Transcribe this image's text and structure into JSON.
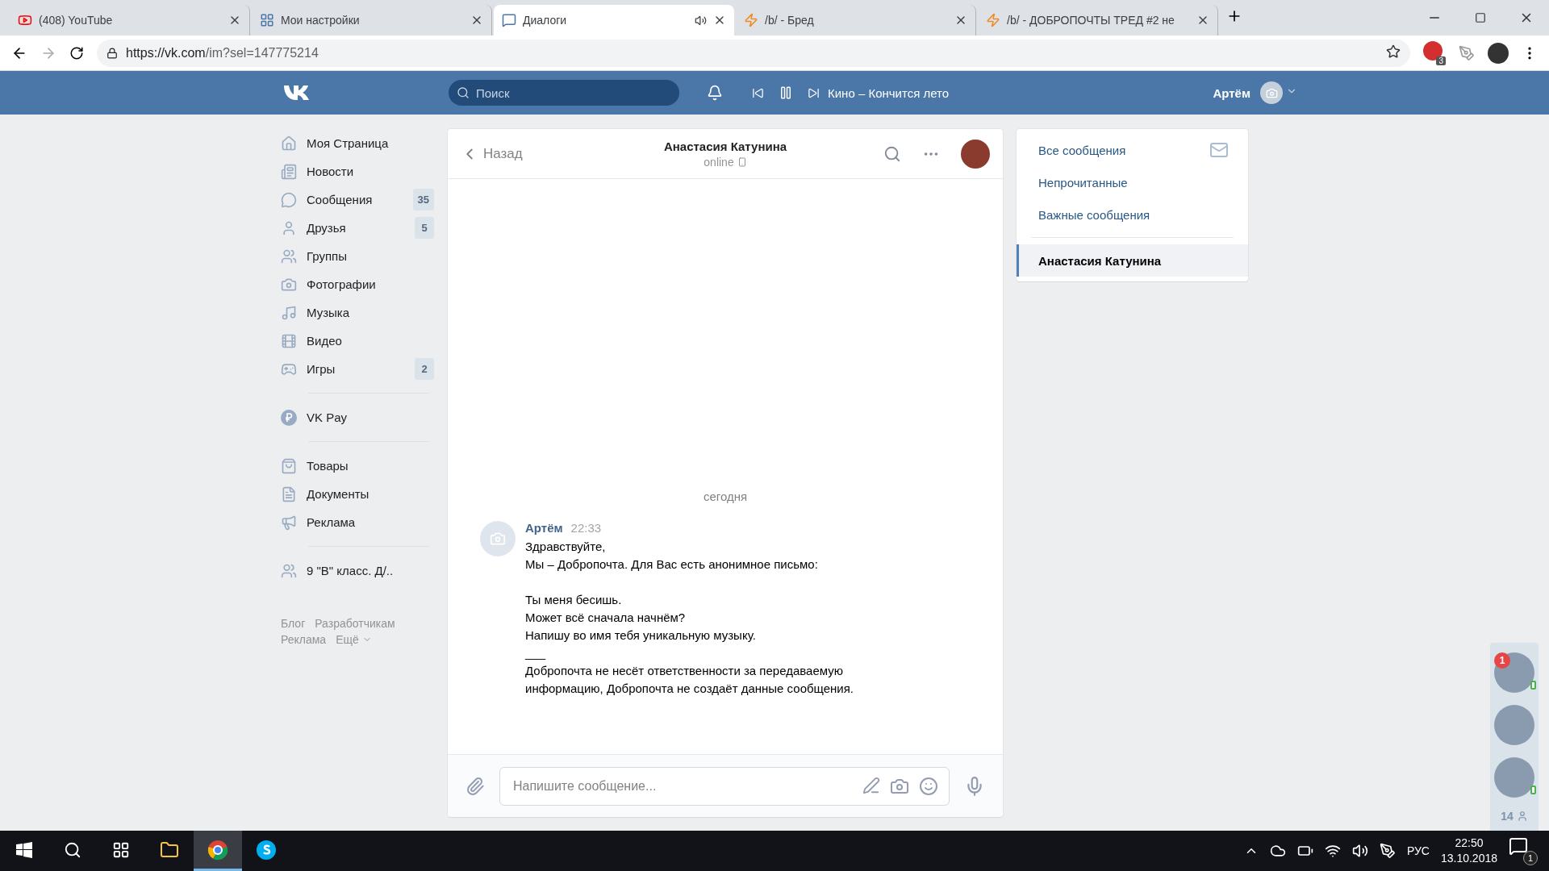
{
  "browser": {
    "tabs": [
      {
        "title": "(408) YouTube",
        "kind": "youtube",
        "selected": false,
        "audio": false
      },
      {
        "title": "Мои настройки",
        "kind": "vk",
        "selected": false,
        "audio": false
      },
      {
        "title": "Диалоги",
        "kind": "chat",
        "selected": true,
        "audio": true
      },
      {
        "title": "/b/ - Бред",
        "kind": "bolt",
        "selected": false,
        "audio": false
      },
      {
        "title": "/b/ - ДОБРОПОЧТЫ ТРЕД #2 не",
        "kind": "bolt",
        "selected": false,
        "audio": false
      }
    ],
    "url_host": "https://vk.com",
    "url_path": "/im?sel=147775214",
    "extension_badge": "3"
  },
  "header": {
    "search_placeholder": "Поиск",
    "track": "Кино – Кончится лето",
    "user": "Артём"
  },
  "sidebar": {
    "groups": [
      [
        {
          "label": "Моя Страница",
          "kind": "home"
        },
        {
          "label": "Новости",
          "kind": "news"
        },
        {
          "label": "Сообщения",
          "kind": "messages",
          "count": "35"
        },
        {
          "label": "Друзья",
          "kind": "user",
          "count": "5"
        },
        {
          "label": "Группы",
          "kind": "users"
        },
        {
          "label": "Фотографии",
          "kind": "camera"
        },
        {
          "label": "Музыка",
          "kind": "music"
        },
        {
          "label": "Видео",
          "kind": "film"
        },
        {
          "label": "Игры",
          "kind": "gamepad",
          "count": "2"
        }
      ],
      [
        {
          "label": "VK Pay",
          "kind": "pay"
        }
      ],
      [
        {
          "label": "Товары",
          "kind": "bag"
        },
        {
          "label": "Документы",
          "kind": "file"
        },
        {
          "label": "Реклама",
          "kind": "megaphone"
        }
      ],
      [
        {
          "label": "9 \"В\" класс. Д/..",
          "kind": "users"
        }
      ]
    ],
    "footer": [
      "Блог",
      "Разработчикам",
      "Реклама",
      "Ещё"
    ]
  },
  "chat": {
    "back": "Назад",
    "name": "Анастасия Катунина",
    "status": "online",
    "date": "сегодня",
    "messages": [
      {
        "author": "Артём",
        "time": "22:33",
        "paragraphs": [
          "Здравствуйте,\nМы – Добропочта. Для Вас есть анонимное письмо:",
          "Ты меня бесишь.\nМожет всё сначала начнём?\nНапишу во имя тебя уникальную музыку.",
          "___",
          "Добропочта не несёт ответственности за передаваемую\nинформацию, Добропочта не создаёт данные сообщения."
        ]
      }
    ],
    "input_placeholder": "Напишите сообщение..."
  },
  "filters": [
    {
      "label": "Все сообщения",
      "selected": false
    },
    {
      "label": "Непрочитанные",
      "selected": false
    },
    {
      "label": "Важные сообщения",
      "selected": false
    },
    {
      "label": "Анастасия Катунина",
      "selected": true
    }
  ],
  "friends": {
    "items": [
      {
        "badge": "1",
        "online": true
      },
      {
        "online": false
      },
      {
        "online": true
      }
    ],
    "count": "14"
  },
  "taskbar": {
    "apps": [
      {
        "kind": "search",
        "selected": false
      },
      {
        "kind": "taskview",
        "selected": false
      },
      {
        "kind": "folder",
        "selected": false
      },
      {
        "kind": "chrome",
        "selected": true
      },
      {
        "kind": "skype",
        "selected": false
      }
    ],
    "language": "РУС",
    "time": "22:50",
    "date": "13.10.2018",
    "notifications": "1"
  }
}
